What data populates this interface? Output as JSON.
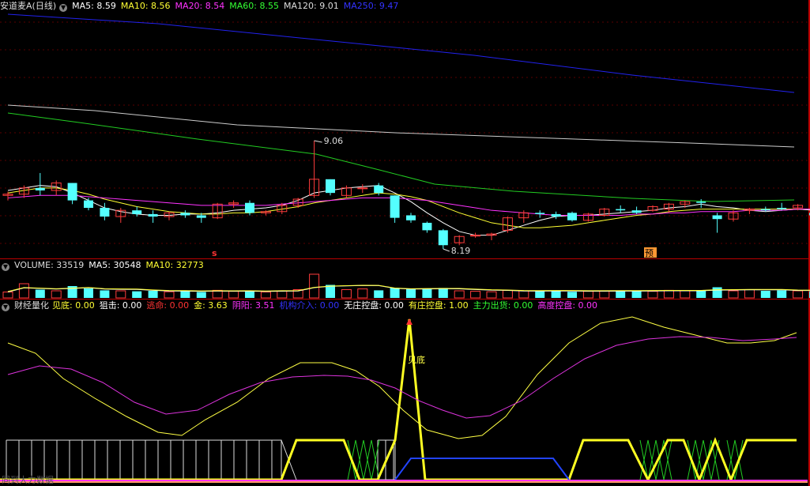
{
  "main_panel": {
    "title": "安道麦A(日线)",
    "ma": [
      {
        "label": "MA5: ",
        "value": "8.59",
        "color": "#ffffff"
      },
      {
        "label": "MA10: ",
        "value": "8.56",
        "color": "#ffff33"
      },
      {
        "label": "MA20: ",
        "value": "8.54",
        "color": "#ff33ff"
      },
      {
        "label": "MA60: ",
        "value": "8.55",
        "color": "#33ff33"
      },
      {
        "label": "MA120: ",
        "value": "9.01",
        "color": "#dddddd"
      },
      {
        "label": "MA250: ",
        "value": "9.47",
        "color": "#3333ff"
      }
    ],
    "high_label": "9.06",
    "low_label": "8.19",
    "signal_s": "s",
    "signal_yu": "预"
  },
  "volume_panel": {
    "items": [
      {
        "label": "VOLUME: ",
        "value": "33519",
        "color": "#dddddd"
      },
      {
        "label": "MA5: ",
        "value": "30548",
        "color": "#ffffff"
      },
      {
        "label": "MA10: ",
        "value": "32773",
        "color": "#ffff33"
      }
    ]
  },
  "indicator_panel": {
    "title": "财经量化",
    "items": [
      {
        "label": "见底: ",
        "value": "0.00",
        "color": "#ffff33"
      },
      {
        "label": "狙击: ",
        "value": "0.00",
        "color": "#ffffff"
      },
      {
        "label": "逃命: ",
        "value": "0.00",
        "color": "#ff3333"
      },
      {
        "label": "金: ",
        "value": "3.63",
        "color": "#ffff33"
      },
      {
        "label": "阴阳: ",
        "value": "3.51",
        "color": "#ff33ff"
      },
      {
        "label": "机构介入: ",
        "value": "0.00",
        "color": "#3333ff"
      },
      {
        "label": "无庄控盘: ",
        "value": "0.00",
        "color": "#ffffff"
      },
      {
        "label": "有庄控盘: ",
        "value": "1.00",
        "color": "#ffff33"
      },
      {
        "label": "主力出货: ",
        "value": "0.00",
        "color": "#33ff33"
      },
      {
        "label": "高度控盘: ",
        "value": "0.00",
        "color": "#ff33ff"
      }
    ],
    "bottom_label": "见底",
    "watermark": "同到大力数据"
  },
  "chart_data": {
    "type": "candlestick",
    "candles": [
      [
        8.62,
        8.65,
        8.58,
        8.63
      ],
      [
        8.63,
        8.7,
        8.6,
        8.68
      ],
      [
        8.68,
        8.8,
        8.62,
        8.66
      ],
      [
        8.66,
        8.74,
        8.62,
        8.72
      ],
      [
        8.72,
        8.72,
        8.55,
        8.58
      ],
      [
        8.58,
        8.6,
        8.5,
        8.52
      ],
      [
        8.52,
        8.56,
        8.42,
        8.45
      ],
      [
        8.45,
        8.52,
        8.4,
        8.5
      ],
      [
        8.5,
        8.53,
        8.45,
        8.47
      ],
      [
        8.47,
        8.5,
        8.4,
        8.45
      ],
      [
        8.45,
        8.49,
        8.42,
        8.48
      ],
      [
        8.48,
        8.5,
        8.44,
        8.46
      ],
      [
        8.46,
        8.48,
        8.4,
        8.44
      ],
      [
        8.44,
        8.56,
        8.43,
        8.55
      ],
      [
        8.55,
        8.58,
        8.52,
        8.56
      ],
      [
        8.56,
        8.58,
        8.46,
        8.48
      ],
      [
        8.48,
        8.5,
        8.46,
        8.49
      ],
      [
        8.49,
        8.56,
        8.47,
        8.54
      ],
      [
        8.54,
        8.6,
        8.52,
        8.59
      ],
      [
        8.62,
        9.06,
        8.6,
        8.75
      ],
      [
        8.75,
        8.75,
        8.62,
        8.64
      ],
      [
        8.62,
        8.7,
        8.6,
        8.68
      ],
      [
        8.68,
        8.71,
        8.64,
        8.68
      ],
      [
        8.7,
        8.72,
        8.62,
        8.64
      ],
      [
        8.62,
        8.62,
        8.4,
        8.44
      ],
      [
        8.46,
        8.48,
        8.4,
        8.42
      ],
      [
        8.4,
        8.41,
        8.32,
        8.34
      ],
      [
        8.34,
        8.35,
        8.19,
        8.22
      ],
      [
        8.24,
        8.3,
        8.22,
        8.29
      ],
      [
        8.3,
        8.32,
        8.28,
        8.3
      ],
      [
        8.3,
        8.32,
        8.26,
        8.31
      ],
      [
        8.34,
        8.45,
        8.32,
        8.44
      ],
      [
        8.44,
        8.5,
        8.4,
        8.48
      ],
      [
        8.48,
        8.5,
        8.44,
        8.47
      ],
      [
        8.47,
        8.49,
        8.43,
        8.45
      ],
      [
        8.48,
        8.49,
        8.41,
        8.42
      ],
      [
        8.42,
        8.48,
        8.41,
        8.47
      ],
      [
        8.46,
        8.52,
        8.45,
        8.51
      ],
      [
        8.51,
        8.54,
        8.48,
        8.5
      ],
      [
        8.5,
        8.53,
        8.47,
        8.48
      ],
      [
        8.5,
        8.54,
        8.49,
        8.53
      ],
      [
        8.51,
        8.56,
        8.48,
        8.55
      ],
      [
        8.55,
        8.58,
        8.52,
        8.57
      ],
      [
        8.57,
        8.59,
        8.52,
        8.56
      ],
      [
        8.46,
        8.48,
        8.32,
        8.43
      ],
      [
        8.43,
        8.5,
        8.41,
        8.48
      ],
      [
        8.5,
        8.52,
        8.47,
        8.51
      ],
      [
        8.51,
        8.53,
        8.49,
        8.5
      ],
      [
        8.52,
        8.56,
        8.5,
        8.51
      ],
      [
        8.52,
        8.55,
        8.5,
        8.54
      ],
      [
        8.48,
        8.5,
        8.44,
        8.46
      ],
      [
        8.48,
        8.56,
        8.46,
        8.54
      ],
      [
        8.54,
        8.6,
        8.52,
        8.58
      ],
      [
        8.58,
        8.6,
        8.54,
        8.55
      ],
      [
        8.55,
        8.64,
        8.54,
        8.64
      ]
    ],
    "ma_lines": {
      "MA5": [
        8.66,
        8.68,
        8.7,
        8.69,
        8.64,
        8.58,
        8.52,
        8.49,
        8.47,
        8.46,
        8.46,
        8.47,
        8.47,
        8.48,
        8.5,
        8.51,
        8.52,
        8.54,
        8.58,
        8.64,
        8.66,
        8.68,
        8.69,
        8.7,
        8.64,
        8.57,
        8.48,
        8.4,
        8.33,
        8.3,
        8.3,
        8.34,
        8.38,
        8.42,
        8.45,
        8.46,
        8.46,
        8.47,
        8.48,
        8.49,
        8.5,
        8.52,
        8.53,
        8.55,
        8.53,
        8.52,
        8.5,
        8.49,
        8.5,
        8.51,
        8.5,
        8.51,
        8.53,
        8.55,
        8.59
      ],
      "MA10": [
        8.64,
        8.66,
        8.68,
        8.68,
        8.66,
        8.63,
        8.59,
        8.56,
        8.53,
        8.51,
        8.49,
        8.48,
        8.47,
        8.47,
        8.48,
        8.48,
        8.49,
        8.51,
        8.53,
        8.56,
        8.58,
        8.6,
        8.62,
        8.64,
        8.63,
        8.61,
        8.58,
        8.53,
        8.48,
        8.44,
        8.4,
        8.38,
        8.36,
        8.36,
        8.37,
        8.38,
        8.4,
        8.42,
        8.44,
        8.46,
        8.47,
        8.49,
        8.5,
        8.51,
        8.51,
        8.51,
        8.51,
        8.51,
        8.51,
        8.51,
        8.51,
        8.52,
        8.53,
        8.54,
        8.56
      ],
      "MA20": [
        8.6,
        8.61,
        8.62,
        8.62,
        8.62,
        8.61,
        8.6,
        8.59,
        8.58,
        8.57,
        8.56,
        8.55,
        8.54,
        8.54,
        8.54,
        8.54,
        8.54,
        8.55,
        8.56,
        8.57,
        8.58,
        8.59,
        8.6,
        8.6,
        8.6,
        8.59,
        8.58,
        8.56,
        8.54,
        8.52,
        8.5,
        8.49,
        8.48,
        8.47,
        8.46,
        8.46,
        8.46,
        8.46,
        8.46,
        8.47,
        8.47,
        8.48,
        8.48,
        8.49,
        8.49,
        8.49,
        8.5,
        8.5,
        8.5,
        8.51,
        8.51,
        8.52,
        8.52,
        8.53,
        8.54
      ]
    },
    "price_range": [
      8.19,
      9.06
    ]
  }
}
